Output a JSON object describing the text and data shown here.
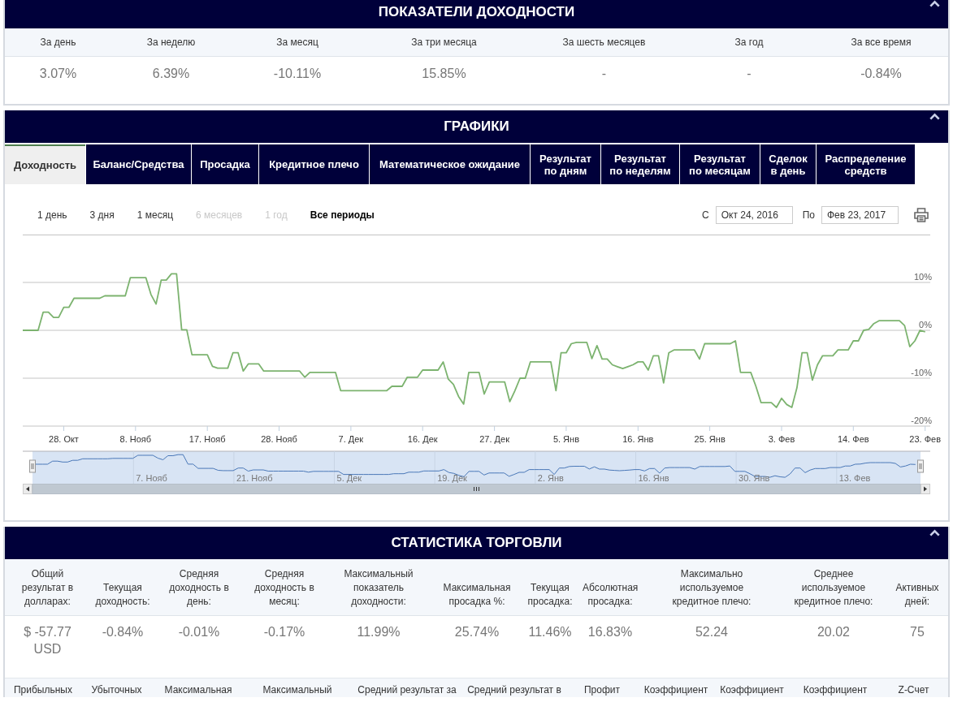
{
  "returns_panel": {
    "title": "ПОКАЗАТЕЛИ ДОХОДНОСТИ",
    "columns": [
      "За день",
      "За неделю",
      "За месяц",
      "За три месяца",
      "За шесть месяцев",
      "За год",
      "За все время"
    ],
    "values": [
      "3.07%",
      "6.39%",
      "-10.11%",
      "15.85%",
      "-",
      "-",
      "-0.84%"
    ]
  },
  "charts_panel": {
    "title": "ГРАФИКИ",
    "tabs": [
      {
        "label": "Доходность",
        "selected": true
      },
      {
        "label": "Баланс/Средства",
        "selected": false
      },
      {
        "label": "Просадка",
        "selected": false
      },
      {
        "label": "Кредитное плечо",
        "selected": false
      },
      {
        "label": "Математическое ожидание",
        "selected": false
      },
      {
        "label": "Результат по дням",
        "selected": false
      },
      {
        "label": "Результат по неделям",
        "selected": false
      },
      {
        "label": "Результат по месяцам",
        "selected": false
      },
      {
        "label": "Сделок в день",
        "selected": false
      },
      {
        "label": "Распределение средств",
        "selected": false
      }
    ],
    "range_buttons": [
      {
        "label": "1 день",
        "selected": false,
        "disabled": false
      },
      {
        "label": "3 дня",
        "selected": false,
        "disabled": false
      },
      {
        "label": "1 месяц",
        "selected": false,
        "disabled": false
      },
      {
        "label": "6 месяцев",
        "selected": false,
        "disabled": true
      },
      {
        "label": "1 год",
        "selected": false,
        "disabled": true
      },
      {
        "label": "Все периоды",
        "selected": true,
        "disabled": false
      }
    ],
    "date_from": {
      "label": "С",
      "value": "Окт 24, 2016"
    },
    "date_to": {
      "label": "По",
      "value": "Фев 23, 2017"
    },
    "chart_data": {
      "type": "line",
      "grid": true,
      "categories": [
        null,
        null,
        null,
        null,
        null,
        null,
        null,
        null,
        "28. Окт",
        null,
        null,
        null,
        null,
        null,
        null,
        null,
        null,
        null,
        null,
        null,
        null,
        null,
        "8. Нояб",
        null,
        null,
        null,
        null,
        null,
        null,
        null,
        null,
        null,
        null,
        null,
        null,
        null,
        "17. Нояб",
        null,
        null,
        null,
        null,
        null,
        null,
        null,
        null,
        null,
        null,
        null,
        null,
        null,
        "28. Нояб",
        null,
        null,
        null,
        null,
        null,
        null,
        null,
        null,
        null,
        null,
        null,
        null,
        null,
        "7. Дек",
        null,
        null,
        null,
        null,
        null,
        null,
        null,
        null,
        null,
        null,
        null,
        null,
        null,
        "16. Дек",
        null,
        null,
        null,
        null,
        null,
        null,
        null,
        null,
        null,
        null,
        null,
        null,
        null,
        "27. Дек",
        null,
        null,
        null,
        null,
        null,
        null,
        null,
        null,
        null,
        null,
        null,
        null,
        null,
        "5. Янв",
        null,
        null,
        null,
        null,
        null,
        null,
        null,
        null,
        null,
        null,
        null,
        null,
        null,
        "16. Янв",
        null,
        null,
        null,
        null,
        null,
        null,
        null,
        null,
        null,
        null,
        null,
        null,
        null,
        "25. Янв",
        null,
        null,
        null,
        null,
        null,
        null,
        null,
        null,
        null,
        null,
        null,
        null,
        null,
        "3. Фев",
        null,
        null,
        null,
        null,
        null,
        null,
        null,
        null,
        null,
        null,
        null,
        null,
        null,
        "14. Фев",
        null,
        null,
        null,
        null,
        null,
        null,
        null,
        null,
        null,
        null,
        null,
        null,
        null,
        "23. Фев"
      ],
      "series": [
        {
          "color": "#7cb36f",
          "values": [
            0,
            0,
            0,
            0,
            3.8,
            3.8,
            2.7,
            2.7,
            4.8,
            4.8,
            6.7,
            6.7,
            6.7,
            6.7,
            6.7,
            6.7,
            7.2,
            7.2,
            7.2,
            7.2,
            7.2,
            11,
            11,
            11,
            11,
            7.5,
            5.5,
            10.5,
            10.5,
            11.8,
            11.8,
            0.1,
            0.1,
            -5.1,
            -5.1,
            -5.1,
            -5.1,
            -7.5,
            -7.9,
            -7.9,
            -7.9,
            -4.7,
            -4.7,
            -8.5,
            -7,
            -7,
            -7,
            -8.5,
            -8.5,
            -8.5,
            -8.5,
            -8.5,
            -8.5,
            -8.5,
            -8.5,
            -9.8,
            -8.8,
            -8.8,
            -8.8,
            -8.8,
            -8.8,
            -8.8,
            -12.6,
            -12.6,
            -12.6,
            -12.6,
            -12.6,
            -12.6,
            -12.6,
            -12.6,
            -12.6,
            -12.6,
            -11.7,
            -11.7,
            -11.7,
            -9.8,
            -9.8,
            -9.8,
            -8.3,
            -8.3,
            -8.3,
            -8.3,
            -6.6,
            -10.2,
            -11.3,
            -13.8,
            -15.4,
            -8.8,
            -8.8,
            -8.8,
            -13.3,
            -10.8,
            -10.8,
            -10.8,
            -10.8,
            -14.9,
            -12.6,
            -10,
            -10,
            -6.6,
            -6.6,
            -6.6,
            -6.6,
            -6.6,
            -12.6,
            -4.7,
            -4.7,
            -2.8,
            -2.5,
            -2.5,
            -2.5,
            -5.9,
            -3.2,
            -6,
            -6,
            -7.2,
            -7.6,
            -8,
            -7.6,
            -7.2,
            -6.6,
            -6.6,
            -8.3,
            -5.3,
            -5.3,
            -11,
            -4.7,
            -4.1,
            -4.1,
            -4.1,
            -4.1,
            -4.1,
            -6,
            -2.8,
            -2.8,
            -2.8,
            -2.8,
            -2.8,
            -2.8,
            -2.2,
            -8.8,
            -8.8,
            -8.8,
            -11.7,
            -15.1,
            -15.1,
            -15.1,
            -16.1,
            -14.2,
            -15.5,
            -16.1,
            -12,
            -4.7,
            -4.7,
            -10.4,
            -7.2,
            -5.3,
            -5.3,
            -5.3,
            -4.1,
            -4.1,
            -4.1,
            -2.2,
            -2.2,
            0,
            0.2,
            1.4,
            2,
            2,
            2,
            2,
            2,
            1,
            -3.4,
            -2.2,
            0,
            -0.3
          ]
        }
      ],
      "ylim": [
        -20,
        20
      ],
      "yticks": [
        {
          "value": 10,
          "label": "10%"
        },
        {
          "value": 0,
          "label": "0%"
        },
        {
          "value": -10,
          "label": "-10%"
        },
        {
          "value": -20,
          "label": "-20%"
        }
      ]
    },
    "navigator": {
      "labels": [
        "7. Нояб",
        "21. Нояб",
        "5. Дек",
        "19. Дек",
        "2. Янв",
        "16. Янв",
        "30. Янв",
        "13. Фев"
      ]
    }
  },
  "stats_panel": {
    "title": "СТАТИСТИКА ТОРГОВЛИ",
    "columns": [
      "Общий результат в долларах:",
      "Текущая доходность:",
      "Средняя доходность в день:",
      "Средняя доходность в месяц:",
      "Максимальный показатель доходности:",
      "Максимальная просадка %:",
      "Текущая просадка:",
      "Абсолютная просадка:",
      "Максимально используемое кредитное плечо:",
      "Среднее используемое кредитное плечо:",
      "Активных дней:"
    ],
    "values": [
      "$ -57.77 USD",
      "-0.84%",
      "-0.01%",
      "-0.17%",
      "11.99%",
      "25.74%",
      "11.46%",
      "16.83%",
      "52.24",
      "20.02",
      "75"
    ],
    "next_columns": [
      "Прибыльных",
      "Убыточных",
      "Максимальная",
      "Максимальный",
      "Средний результат за",
      "Средний результат в",
      "Профит",
      "Коэффициент",
      "Коэффициент",
      "Коэффициент",
      "Z-Счет"
    ]
  }
}
